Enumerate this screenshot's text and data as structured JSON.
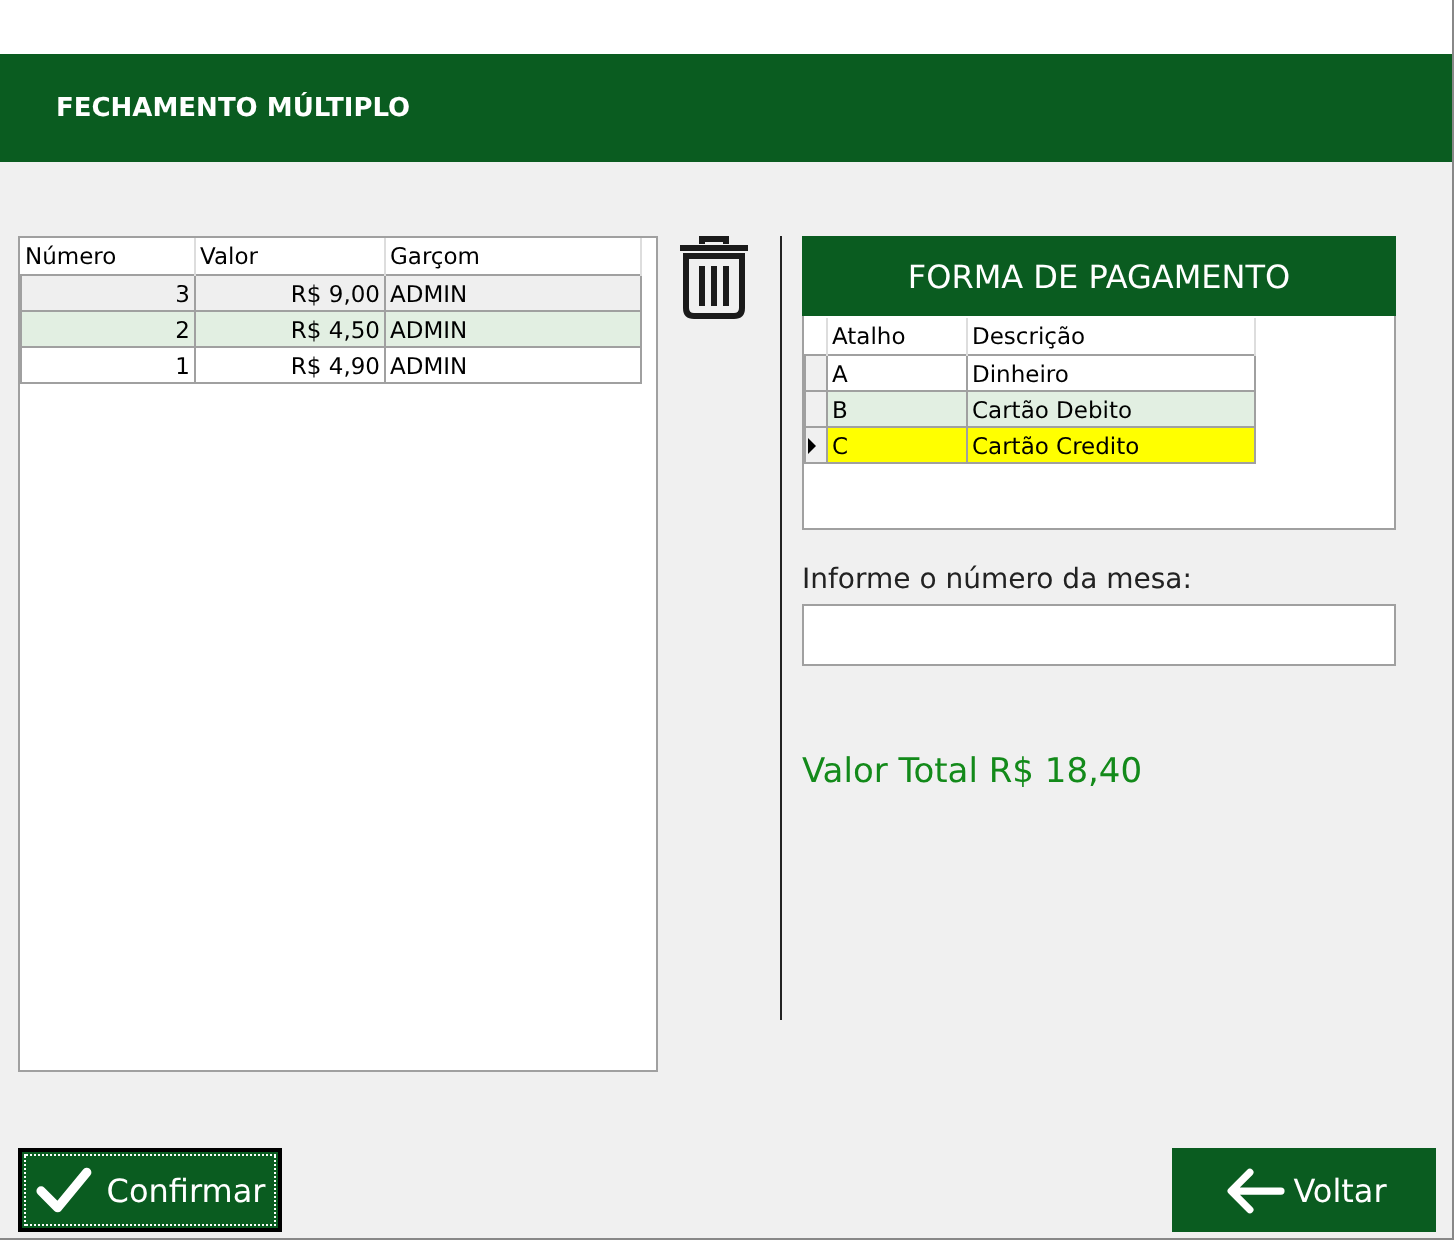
{
  "header": {
    "title": "FECHAMENTO MÚLTIPLO"
  },
  "orders_table": {
    "columns": [
      "Número",
      "Valor",
      "Garçom"
    ],
    "rows": [
      {
        "cells": [
          "3",
          "R$ 9,00",
          "ADMIN"
        ],
        "selected": true
      },
      {
        "cells": [
          "2",
          "R$ 4,50",
          "ADMIN"
        ],
        "selected": false
      },
      {
        "cells": [
          "1",
          "R$ 4,90",
          "ADMIN"
        ],
        "selected": false
      }
    ]
  },
  "payment": {
    "title": "FORMA DE PAGAMENTO",
    "columns": [
      "Atalho",
      "Descrição"
    ],
    "rows": [
      {
        "cells": [
          "A",
          "Dinheiro"
        ],
        "selected": false
      },
      {
        "cells": [
          "B",
          "Cartão Debito"
        ],
        "selected": false
      },
      {
        "cells": [
          "C",
          "Cartão Credito"
        ],
        "selected": true
      }
    ]
  },
  "table_field": {
    "label": "Informe o número da mesa:"
  },
  "total": "Valor Total R$ 18,40",
  "buttons": [
    {
      "kind": "confirm",
      "label": "Confirmar",
      "focused": true
    },
    {
      "kind": "back",
      "label": "Voltar",
      "focused": false
    }
  ]
}
